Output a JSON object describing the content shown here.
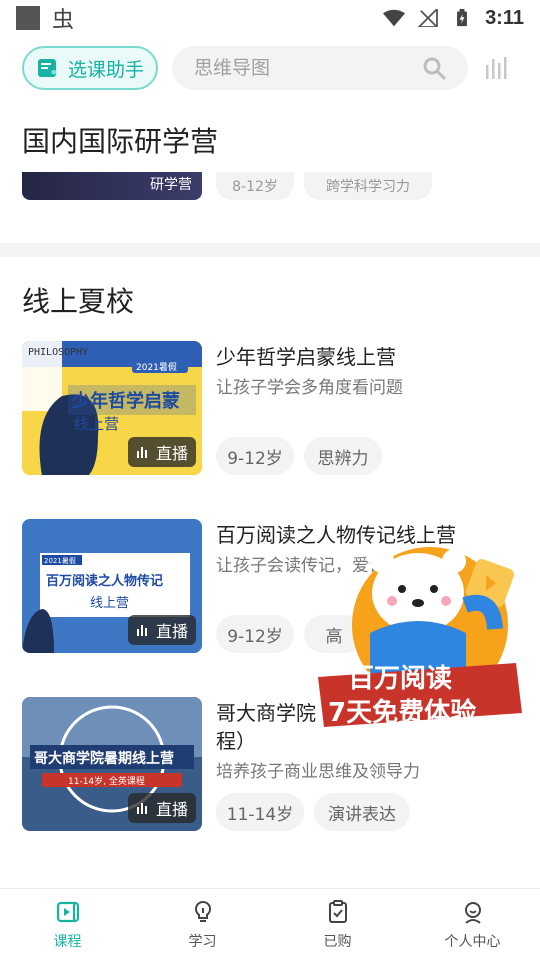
{
  "status_bar": {
    "app_glyph": "虫",
    "time": "3:11"
  },
  "header": {
    "assistant_label": "选课助手",
    "search_placeholder": "思维导图"
  },
  "sections": [
    {
      "title": "国内国际研学营",
      "partial_card": {
        "thumb_text": "研学营",
        "tags": [
          "8-12岁",
          "跨学科学习力"
        ]
      }
    },
    {
      "title": "线上夏校",
      "courses": [
        {
          "title": "少年哲学启蒙线上营",
          "subtitle": "让孩子学会多角度看问题",
          "badge": "直播",
          "tags": [
            "9-12岁",
            "思辨力"
          ],
          "thumb_texts": {
            "brand": "PHILOSOPHY",
            "season": "2021暑假",
            "line1": "少年哲学启蒙",
            "line2": "线上营"
          }
        },
        {
          "title": "百万阅读之人物传记线上营",
          "subtitle": "让孩子会读传记，爱读",
          "badge": "直播",
          "tags": [
            "9-12岁",
            "高"
          ],
          "thumb_texts": {
            "season": "2021暑假",
            "line1": "百万阅读之人物传记",
            "line2": "线上营"
          }
        },
        {
          "title": "哥大商学院暑期线上营（课程）",
          "title_visible_line1": "哥大商学院",
          "title_visible_line2": "程）",
          "subtitle": "培养孩子商业思维及领导力",
          "badge": "直播",
          "tags": [
            "11-14岁",
            "演讲表达"
          ],
          "thumb_texts": {
            "line1": "哥大商学院暑期线上营",
            "line2": "11-14岁, 全英课程"
          }
        }
      ]
    }
  ],
  "promo": {
    "line1": "百万阅读",
    "line2": "7天免费体验"
  },
  "bottom_nav": [
    {
      "label": "课程",
      "active": true
    },
    {
      "label": "学习",
      "active": false
    },
    {
      "label": "已购",
      "active": false
    },
    {
      "label": "个人中心",
      "active": false
    }
  ],
  "colors": {
    "accent": "#17b3a3",
    "tag_bg": "#f3f3f3",
    "divider": "#f2f3f5",
    "promo_red": "#c8332a",
    "promo_orange": "#f7a21b"
  }
}
